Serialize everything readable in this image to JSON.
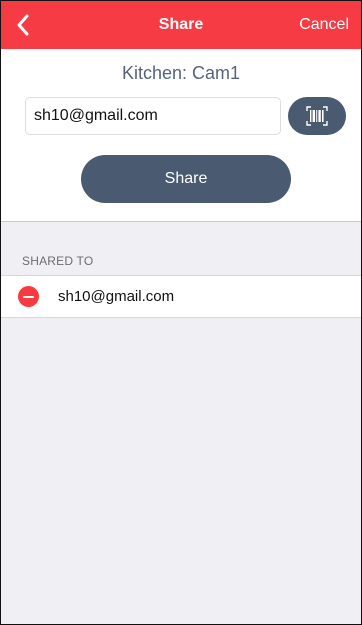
{
  "header": {
    "title": "Share",
    "cancel_label": "Cancel"
  },
  "device": {
    "name": "Kitchen: Cam1"
  },
  "form": {
    "email_value": "sh10@gmail.com",
    "share_label": "Share"
  },
  "shared": {
    "section_title": "SHARED TO",
    "items": [
      {
        "email": "sh10@gmail.com"
      }
    ]
  },
  "colors": {
    "accent": "#f73b45",
    "button": "#4a5a70",
    "remove": "#f8393f",
    "background": "#efeff4"
  },
  "icons": {
    "back": "chevron-left-icon",
    "scan": "barcode-scan-icon",
    "remove": "minus-circle-icon"
  }
}
